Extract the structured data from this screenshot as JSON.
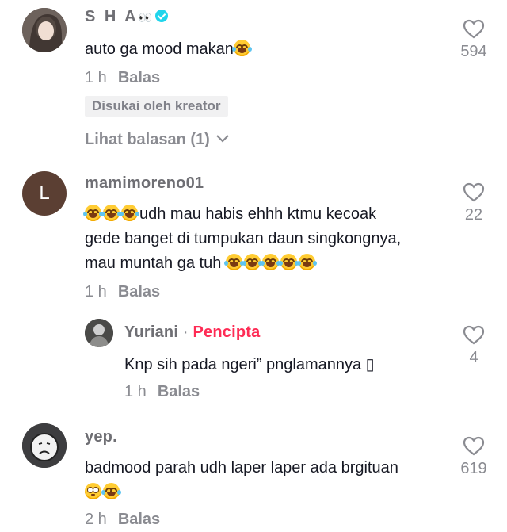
{
  "comments": [
    {
      "username": "S H A",
      "username_suffix": "👀",
      "verified": true,
      "text": "auto ga mood makan",
      "time": "1 h",
      "reply_label": "Balas",
      "badge": "Disukai oleh kreator",
      "view_replies": "Lihat balasan (1)",
      "likes": "594"
    },
    {
      "username": "mamimoreno01",
      "avatar_letter": "L",
      "text_line1": "udh mau habis ehhh ktmu kecoak",
      "text_line2": "gede banget di tumpukan daun singkongnya,",
      "text_line3": "mau muntah ga tuh",
      "time": "1 h",
      "reply_label": "Balas",
      "likes": "22"
    },
    {
      "username": "Yuriani",
      "separator": " · ",
      "creator_label": "Pencipta",
      "text": "Knp sih pada ngeri” pnglamannya ▯",
      "time": "1 h",
      "reply_label": "Balas",
      "likes": "4"
    },
    {
      "username": "yep.",
      "text_line1": "badmood parah udh laper laper ada brgituan",
      "time": "2 h",
      "reply_label": "Balas",
      "likes": "619"
    }
  ],
  "icons": {
    "like": "heart-outline-icon",
    "chevron": "chevron-down-icon",
    "verified": "verified-badge-icon"
  },
  "colors": {
    "creator": "#fe2c55",
    "verified": "#20d5ec",
    "muted": "#8a8b91"
  }
}
